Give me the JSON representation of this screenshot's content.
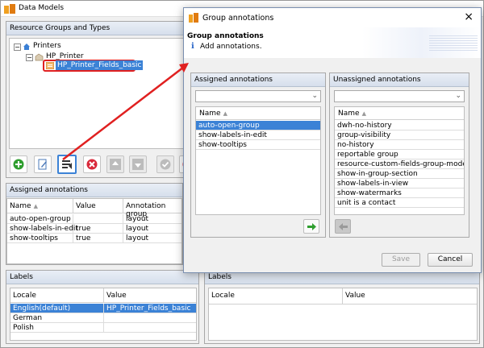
{
  "window": {
    "title": "Data Models"
  },
  "resource_panel": {
    "title": "Resource Groups and Types",
    "tree": [
      {
        "label": "Printers",
        "level": 0
      },
      {
        "label": "HP_Printer",
        "level": 1
      },
      {
        "label": "HP_Printer_Fields_basic",
        "level": 2,
        "selected": true
      }
    ]
  },
  "assigned_panel": {
    "title": "Assigned annotations",
    "columns": [
      "Name",
      "Value",
      "Annotation group"
    ],
    "rows": [
      {
        "name": "auto-open-group",
        "value": "",
        "group": "layout"
      },
      {
        "name": "show-labels-in-edit",
        "value": "true",
        "group": "layout"
      },
      {
        "name": "show-tooltips",
        "value": "true",
        "group": "layout"
      }
    ]
  },
  "labels_left": {
    "title": "Labels",
    "columns": [
      "Locale",
      "Value"
    ],
    "rows": [
      {
        "locale": "English(default)",
        "value": "HP_Printer_Fields_basic",
        "selected": true
      },
      {
        "locale": "German",
        "value": ""
      },
      {
        "locale": "Polish",
        "value": ""
      }
    ]
  },
  "labels_right": {
    "title": "Labels",
    "columns": [
      "Locale",
      "Value"
    ]
  },
  "dialog": {
    "title": "Group annotations",
    "heading": "Group annotations",
    "subtitle": "Add annotations.",
    "close_glyph": "×",
    "assigned": {
      "title": "Assigned annotations",
      "column": "Name",
      "items": [
        "auto-open-group",
        "show-labels-in-edit",
        "show-tooltips"
      ],
      "selected_index": 0
    },
    "unassigned": {
      "title": "Unassigned annotations",
      "column": "Name",
      "items": [
        "dwh-no-history",
        "group-visibility",
        "no-history",
        "reportable group",
        "resource-custom-fields-group-mode",
        "show-in-group-section",
        "show-labels-in-view",
        "show-watermarks",
        "unit is a contact"
      ]
    },
    "save_label": "Save",
    "cancel_label": "Cancel"
  },
  "colors": {
    "selection": "#3b82d6",
    "highlight_red": "#e02020",
    "accent_green": "#2f9e2f",
    "title_icon_orange": "#f0a020"
  }
}
